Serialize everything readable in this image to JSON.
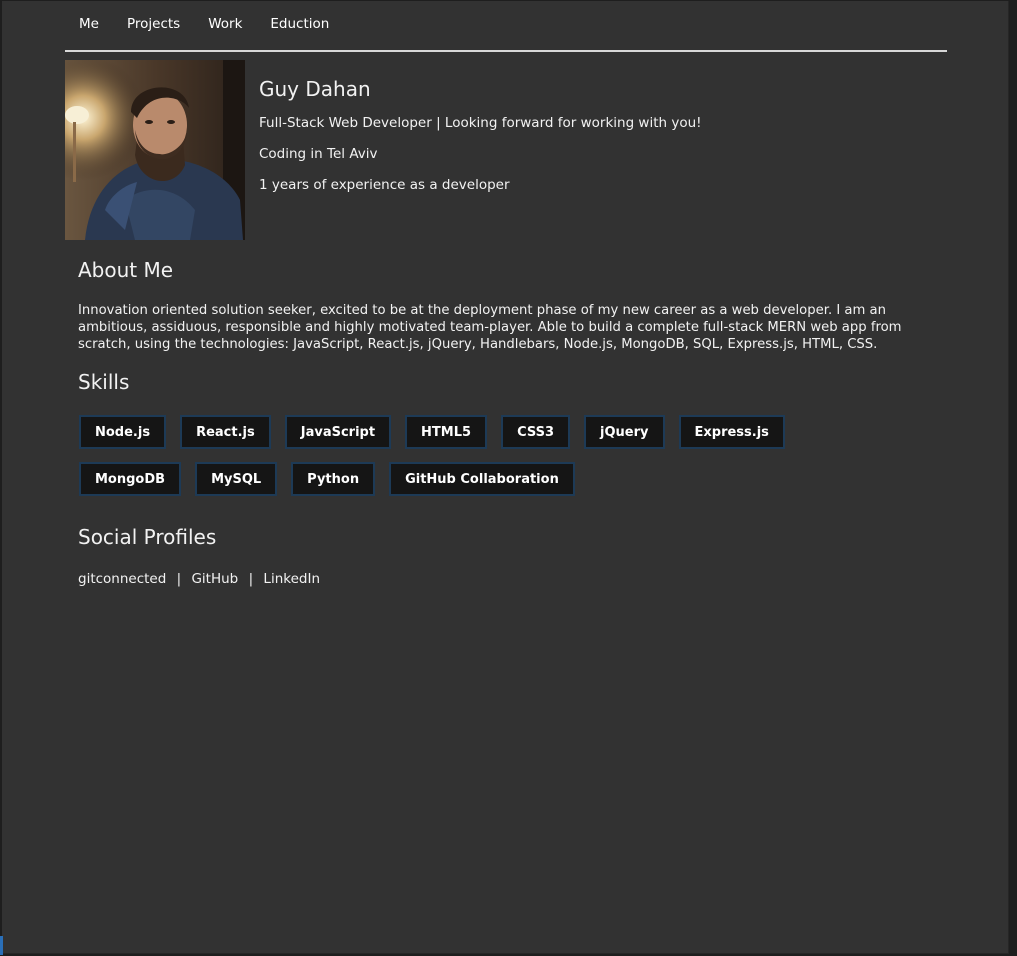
{
  "nav": {
    "items": [
      {
        "label": "Me"
      },
      {
        "label": "Projects"
      },
      {
        "label": "Work"
      },
      {
        "label": "Eduction"
      }
    ]
  },
  "profile": {
    "name": "Guy Dahan",
    "headline": "Full-Stack Web Developer | Looking forward for working with you!",
    "location": "Coding in Tel Aviv",
    "experience": "1 years of experience as a developer"
  },
  "about": {
    "title": "About Me",
    "text": "Innovation oriented solution seeker, excited to be at the deployment phase of my new career as a web developer. I am an ambitious, assiduous, responsible and highly motivated team-player. Able to build a complete full-stack MERN web app from scratch, using the technologies: JavaScript, React.js, jQuery, Handlebars, Node.js, MongoDB, SQL, Express.js, HTML, CSS."
  },
  "skills": {
    "title": "Skills",
    "items": [
      {
        "label": "Node.js"
      },
      {
        "label": "React.js"
      },
      {
        "label": "JavaScript"
      },
      {
        "label": "HTML5"
      },
      {
        "label": "CSS3"
      },
      {
        "label": "jQuery"
      },
      {
        "label": "Express.js"
      },
      {
        "label": "MongoDB"
      },
      {
        "label": "MySQL"
      },
      {
        "label": "Python"
      },
      {
        "label": "GitHub Collaboration"
      }
    ]
  },
  "social": {
    "title": "Social Profiles",
    "links": [
      {
        "label": "gitconnected"
      },
      {
        "label": "GitHub"
      },
      {
        "label": "LinkedIn"
      }
    ],
    "separator": "|"
  },
  "colors": {
    "page_background": "#323232",
    "skill_background": "#151515",
    "skill_border": "#1d3a56",
    "divider": "#d8d8d8"
  }
}
